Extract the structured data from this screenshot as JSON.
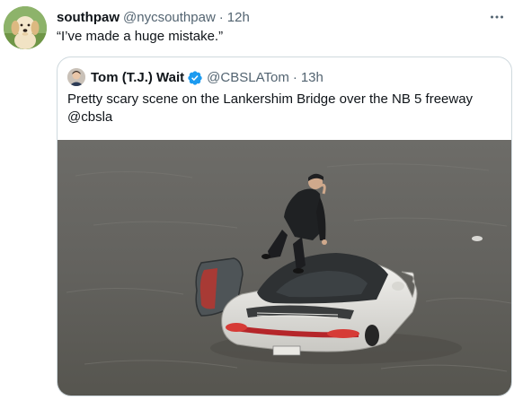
{
  "tweet": {
    "author_name": "southpaw",
    "author_handle": "@nycsouthpaw",
    "separator": "·",
    "time": "12h",
    "text": "“I’ve made a huge mistake.”",
    "avatar_icon": "golden-retriever-puppy-avatar",
    "more_icon": "more-horizontal-icon"
  },
  "quoted": {
    "author_name": "Tom (T.J.) Wait",
    "verified_icon": "verified-badge-icon",
    "author_handle": "@CBSLATom",
    "separator": "·",
    "time": "13h",
    "text": "Pretty scary scene on the Lankershim Bridge over the NB 5 freeway @cbsla",
    "media_icon": "flooded-car-photo"
  },
  "colors": {
    "text_primary": "#0f1419",
    "text_secondary": "#536471",
    "border": "#cfd9de",
    "verified": "#1d9bf0"
  }
}
